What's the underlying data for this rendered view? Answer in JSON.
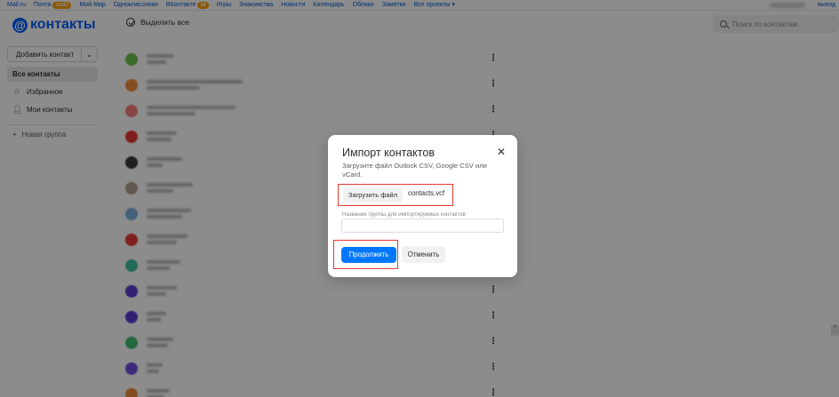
{
  "portal": {
    "links": [
      {
        "label": "Mail.ru"
      },
      {
        "label": "Почта",
        "badge": "11657"
      },
      {
        "label": "Мой Мир"
      },
      {
        "label": "Одноклассники"
      },
      {
        "label": "ВКонтакте",
        "badge": "58"
      },
      {
        "label": "Игры"
      },
      {
        "label": "Знакомства"
      },
      {
        "label": "Новости"
      },
      {
        "label": "Календарь"
      },
      {
        "label": "Облако"
      },
      {
        "label": "Заметки"
      },
      {
        "label": "Все проекты ▾"
      }
    ],
    "logout": "выход"
  },
  "header": {
    "logo_symbol": "@",
    "logo_text": "контакты",
    "select_all": "Выделить все",
    "search_placeholder": "Поиск по контактам"
  },
  "sidebar": {
    "add_contact": "Добавить контакт",
    "items": [
      {
        "label": "Все контакты",
        "icon": "none"
      },
      {
        "label": "Избранное",
        "icon": "star-icon"
      },
      {
        "label": "Мои контакты",
        "icon": "person-icon"
      }
    ],
    "new_group": "Новая группа"
  },
  "contacts": {
    "avatar_colors": [
      "#6cc04a",
      "#f08c3c",
      "#f47c7c",
      "#e53935",
      "#3a3a3a",
      "#b0a090",
      "#7fb0e0",
      "#e53935",
      "#3fbf9f",
      "#5b3ccf",
      "#5b3ccf",
      "#3fbf6f",
      "#6f4fdf",
      "#f08c3c"
    ]
  },
  "modal": {
    "title": "Импорт контактов",
    "description": "Загрузите файл Outlook CSV, Google CSV или vCard.",
    "upload_button": "Загрузить файл",
    "file_name": "contacts.vcf",
    "group_label": "Название группы для импортируемых контактов",
    "group_value": "",
    "continue_button": "Продолжить",
    "cancel_button": "Отменить",
    "accent_color": "#0077ff",
    "highlight_color": "#e53935"
  }
}
